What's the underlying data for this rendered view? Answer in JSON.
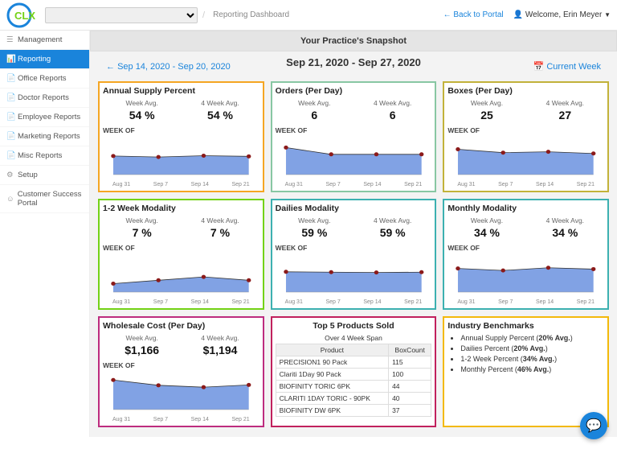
{
  "header": {
    "breadcrumb": "Reporting Dashboard",
    "back_link": "← Back to Portal",
    "welcome_prefix": "Welcome, ",
    "user_name": "Erin Meyer"
  },
  "sidebar": {
    "items": [
      {
        "label": "Management"
      },
      {
        "label": "Reporting",
        "active": true
      },
      {
        "label": "Office Reports"
      },
      {
        "label": "Doctor Reports"
      },
      {
        "label": "Employee Reports"
      },
      {
        "label": "Marketing Reports"
      },
      {
        "label": "Misc Reports"
      },
      {
        "label": "Setup"
      },
      {
        "label": "Customer Success Portal"
      }
    ]
  },
  "snapshot": {
    "title": "Your Practice's Snapshot",
    "prev_range_label": "Sep 14, 2020 - Sep 20, 2020",
    "current_range": "Sep 21, 2020 - Sep 27, 2020",
    "current_week_label": "Current Week"
  },
  "labels": {
    "week_avg": "Week Avg.",
    "four_week_avg": "4 Week Avg.",
    "week_of": "WEEK OF"
  },
  "xticks": [
    "Aug 31",
    "Sep 7",
    "Sep 14",
    "Sep 21"
  ],
  "cards": {
    "annual_supply": {
      "title": "Annual Supply Percent",
      "week_avg": "54 %",
      "four_week_avg": "54 %"
    },
    "orders": {
      "title": "Orders (Per Day)",
      "week_avg": "6",
      "four_week_avg": "6"
    },
    "boxes": {
      "title": "Boxes (Per Day)",
      "week_avg": "25",
      "four_week_avg": "27"
    },
    "mod12": {
      "title": "1-2 Week Modality",
      "week_avg": "7 %",
      "four_week_avg": "7 %"
    },
    "dailies": {
      "title": "Dailies Modality",
      "week_avg": "59 %",
      "four_week_avg": "59 %"
    },
    "monthly": {
      "title": "Monthly Modality",
      "week_avg": "34 %",
      "four_week_avg": "34 %"
    },
    "wholesale": {
      "title": "Wholesale Cost (Per Day)",
      "week_avg": "$1,166",
      "four_week_avg": "$1,194"
    }
  },
  "top5": {
    "title": "Top 5 Products Sold",
    "subtitle": "Over 4 Week Span",
    "col_product": "Product",
    "col_boxcount": "BoxCount",
    "rows": [
      {
        "product": "PRECISION1 90 Pack",
        "count": "115"
      },
      {
        "product": "Clariti 1Day 90 Pack",
        "count": "100"
      },
      {
        "product": "BIOFINITY TORIC 6PK",
        "count": "44"
      },
      {
        "product": "CLARITI 1DAY TORIC - 90PK",
        "count": "40"
      },
      {
        "product": "BIOFINITY DW 6PK",
        "count": "37"
      }
    ]
  },
  "benchmarks": {
    "title": "Industry Benchmarks",
    "items": [
      {
        "label": "Annual Supply Percent",
        "pct": "20% Avg."
      },
      {
        "label": "Dailies Percent",
        "pct": "20% Avg."
      },
      {
        "label": "1-2 Week Percent",
        "pct": "34% Avg."
      },
      {
        "label": "Monthly Percent",
        "pct": "46% Avg."
      }
    ]
  },
  "chart_data": [
    {
      "card": "annual_supply",
      "type": "area",
      "categories": [
        "Aug 31",
        "Sep 7",
        "Sep 14",
        "Sep 21"
      ],
      "values": [
        55,
        52,
        56,
        54
      ],
      "ylim": [
        0,
        100
      ]
    },
    {
      "card": "orders",
      "type": "area",
      "categories": [
        "Aug 31",
        "Sep 7",
        "Sep 14",
        "Sep 21"
      ],
      "values": [
        8,
        6,
        6,
        6
      ],
      "ylim": [
        0,
        10
      ]
    },
    {
      "card": "boxes",
      "type": "area",
      "categories": [
        "Aug 31",
        "Sep 7",
        "Sep 14",
        "Sep 21"
      ],
      "values": [
        30,
        26,
        27,
        25
      ],
      "ylim": [
        0,
        40
      ]
    },
    {
      "card": "mod12",
      "type": "area",
      "categories": [
        "Aug 31",
        "Sep 7",
        "Sep 14",
        "Sep 21"
      ],
      "values": [
        5,
        7,
        9,
        7
      ],
      "ylim": [
        0,
        20
      ]
    },
    {
      "card": "dailies",
      "type": "area",
      "categories": [
        "Aug 31",
        "Sep 7",
        "Sep 14",
        "Sep 21"
      ],
      "values": [
        60,
        59,
        58,
        59
      ],
      "ylim": [
        0,
        100
      ]
    },
    {
      "card": "monthly",
      "type": "area",
      "categories": [
        "Aug 31",
        "Sep 7",
        "Sep 14",
        "Sep 21"
      ],
      "values": [
        35,
        32,
        36,
        34
      ],
      "ylim": [
        0,
        50
      ]
    },
    {
      "card": "wholesale",
      "type": "area",
      "categories": [
        "Aug 31",
        "Sep 7",
        "Sep 14",
        "Sep 21"
      ],
      "values": [
        1400,
        1150,
        1060,
        1166
      ],
      "ylim": [
        0,
        1600
      ]
    }
  ]
}
